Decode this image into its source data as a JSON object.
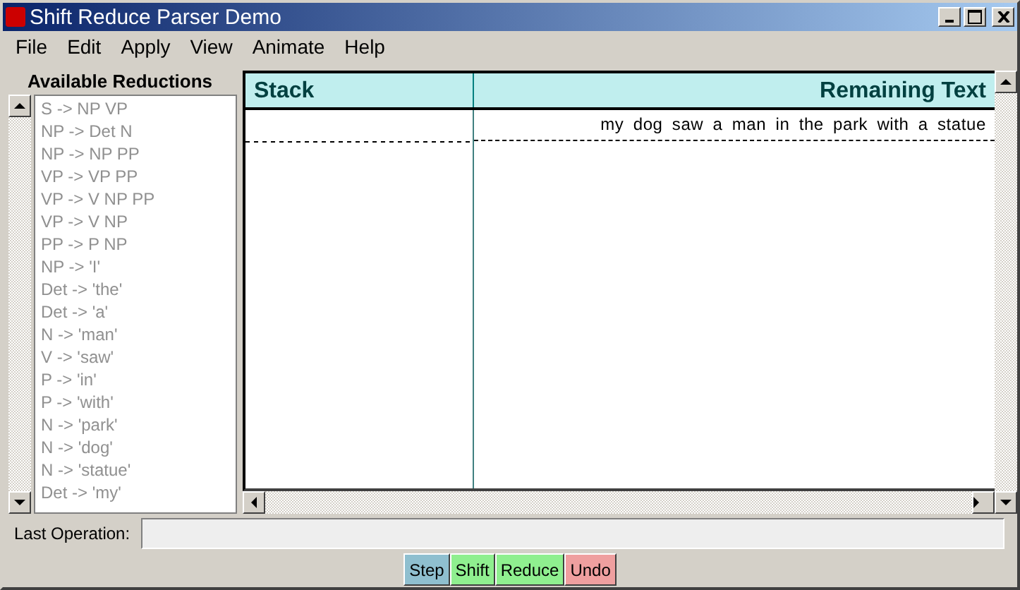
{
  "window": {
    "title": "Shift Reduce Parser Demo"
  },
  "menu": [
    "File",
    "Edit",
    "Apply",
    "View",
    "Animate",
    "Help"
  ],
  "reductions": {
    "title": "Available Reductions",
    "items": [
      {
        "label": "S -> NP VP",
        "disabled": true
      },
      {
        "label": "NP -> Det N",
        "disabled": true
      },
      {
        "label": "NP -> NP PP",
        "disabled": true
      },
      {
        "label": "VP -> VP PP",
        "disabled": true
      },
      {
        "label": "VP -> V NP PP",
        "disabled": true
      },
      {
        "label": "VP -> V NP",
        "disabled": true
      },
      {
        "label": "PP -> P NP",
        "disabled": true
      },
      {
        "label": "NP -> 'I'",
        "disabled": true
      },
      {
        "label": "Det -> 'the'",
        "disabled": true
      },
      {
        "label": "Det -> 'a'",
        "disabled": true
      },
      {
        "label": "N -> 'man'",
        "disabled": true
      },
      {
        "label": "V -> 'saw'",
        "disabled": true
      },
      {
        "label": "P -> 'in'",
        "disabled": true
      },
      {
        "label": "P -> 'with'",
        "disabled": true
      },
      {
        "label": "N -> 'park'",
        "disabled": true
      },
      {
        "label": "N -> 'dog'",
        "disabled": true
      },
      {
        "label": "N -> 'statue'",
        "disabled": true
      },
      {
        "label": "Det -> 'my'",
        "disabled": true
      }
    ]
  },
  "table": {
    "columns": [
      "Stack",
      "Remaining Text"
    ],
    "remaining_text": "my dog saw a man in the park with a statue"
  },
  "last_operation": {
    "label": "Last Operation:"
  },
  "buttons": [
    {
      "label": "Step",
      "color": "#8fbfcf"
    },
    {
      "label": "Shift",
      "color": "#8fef8f"
    },
    {
      "label": "Reduce",
      "color": "#8fef8f"
    },
    {
      "label": "Undo",
      "color": "#ef9f9f"
    }
  ]
}
